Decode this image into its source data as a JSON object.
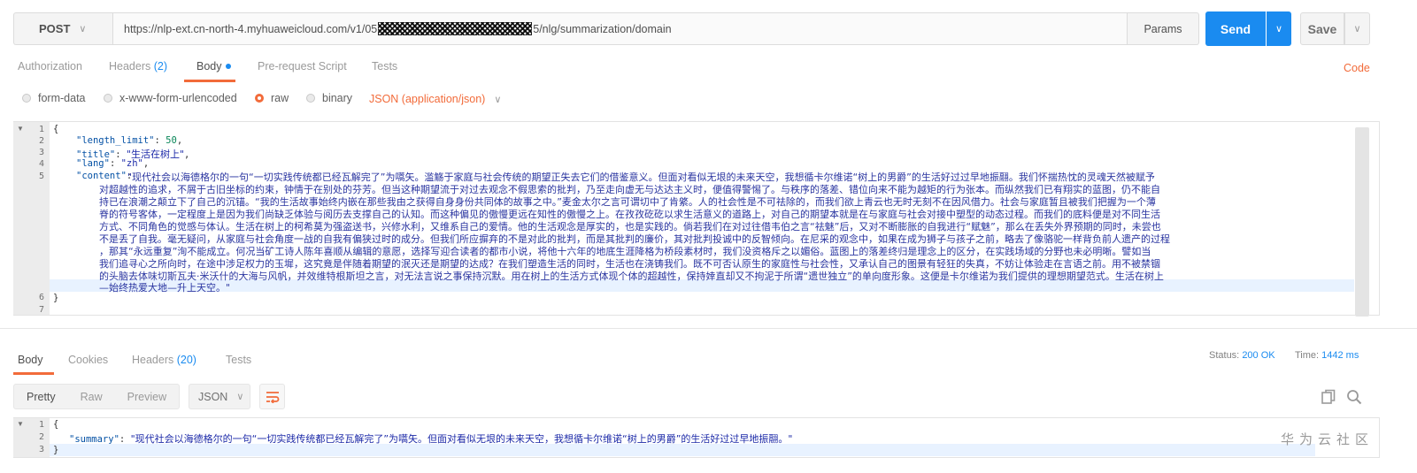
{
  "request": {
    "method": "POST",
    "url_prefix": "https://nlp-ext.cn-north-4.myhuaweicloud.com/v1/05",
    "url_suffix": "5/nlg/summarization/domain",
    "params_label": "Params",
    "send_label": "Send",
    "save_label": "Save"
  },
  "tabs": [
    {
      "label": "Authorization"
    },
    {
      "label": "Headers",
      "count": "(2)"
    },
    {
      "label": "Body"
    },
    {
      "label": "Pre-request Script"
    },
    {
      "label": "Tests"
    }
  ],
  "code_link": "Code",
  "body_types": [
    "form-data",
    "x-www-form-urlencoded",
    "raw",
    "binary"
  ],
  "selected_body_type": "raw",
  "content_type": "JSON (application/json)",
  "editor": {
    "line_numbers": [
      "1",
      "2",
      "3",
      "4",
      "5",
      "6",
      "7"
    ],
    "length_limit_key": "\"length_limit\"",
    "length_limit_value": "50",
    "title_key": "\"title\"",
    "title_value": "\"生活在树上\"",
    "lang_key": "\"lang\"",
    "lang_value": "\"zh\"",
    "content_key": "\"content\"",
    "content_lines": [
      "\"现代社会以海德格尔的一句“一切实践传统都已经瓦解完了”为嚆矢。滥觞于家庭与社会传统的期望正失去它们的借鉴意义。但面对看似无垠的未来天空，我想循卡尔维诺“树上的男爵”的生活好过过早地振翮。我们怀揣热忱的灵魂天然被赋予",
      "对超越性的追求，不屑于古旧坐标的约束，钟情于在别处的芬芳。但当这种期望流于对过去观念不假思索的批判，乃至走向虚无与达达主义时，便值得警惕了。与秩序的落差、错位向来不能为越矩的行为张本。而纵然我们已有翔实的蓝图，仍不能自",
      "持已在浪潮之颠立下了自己的沉锚。“我的生活故事始终内嵌在那些我由之获得自身身份共同体的故事之中。”麦金太尔之言可谓切中了肯綮。人的社会性是不可祛除的，而我们欲上青云也无时无刻不在因风借力。社会与家庭暂且被我们把握为一个薄",
      "脊的符号客体，一定程度上是因为我们尚缺乏体验与阅历去支撑自己的认知。而这种偏见的傲慢更远在知性的傲慢之上。在孜孜矻矻以求生活意义的道路上，对自己的期望本就是在与家庭与社会对接中塑型的动态过程。而我们的底料便是对不同生活",
      "方式、不同角色的觉感与体认。生活在树上的柯希莫为强盗送书，兴修水利，又维系自己的爱情。他的生活观念是厚实的，也是实践的。倘若我们在对过往借韦伯之言“祛魅”后，又对不断膨胀的自我进行“赋魅”，那么在丢失外界预期的同时，未尝也",
      "不是丢了自我。毫无疑问，从家庭与社会角度一战的自我有偏狭过时的成分。但我们所应摒弃的不是对此的批判，而是其批判的廉价，其对批判投诚中的反智倾向。在尼采的观念中，如果在成为狮子与孩子之前，略去了像骆驼一样背负前人遗产的过程",
      "，那其“永远重复”洵不能成立。何况当矿工诗人陈年喜顺从编辑的意愿，选择写迎合读者的都市小说，将他十六年的地底生涯降格为桥段素材时，我们没资格斥之以媚俗。蓝图上的落差终归是理念上的区分，在实践场域的分野也未必明晰。譬如当",
      "我们追寻心之所向时，在途中涉足权力的玉墀，这究竟是伴随着期望的泯灭还是期望的达成？在我们塑造生活的同时，生活也在浇铸我们。既不可否认原生的家庭性与社会性，又承认自己的图景有轻狂的失真，不妨让体验走在言语之前。用不被禁锢",
      "的头脑去体味切斯瓦夫·米沃什的大海与风帆，并效维特根斯坦之言，对无法言说之事保持沉默。用在树上的生活方式体现个体的超越性，保持婞直却又不拘泥于所谓“遗世独立”的单向度形象。这便是卡尔维诺为我们提供的理想期望范式。生活在树上",
      "—始终热爱大地—升上天空。\""
    ]
  },
  "response": {
    "tabs": [
      {
        "label": "Body"
      },
      {
        "label": "Cookies"
      },
      {
        "label": "Headers",
        "count": "(20)"
      },
      {
        "label": "Tests"
      }
    ],
    "status_label": "Status:",
    "status_value": "200 OK",
    "time_label": "Time:",
    "time_value": "1442 ms",
    "view_modes": [
      "Pretty",
      "Raw",
      "Preview"
    ],
    "format": "JSON",
    "line_numbers": [
      "1",
      "2",
      "3"
    ],
    "summary_key": "\"summary\"",
    "summary_value": "\"现代社会以海德格尔的一句“一切实践传统都已经瓦解完了”为嚆矢。但面对看似无垠的未来天空，我想循卡尔维诺“树上的男爵”的生活好过过早地振翮。\""
  },
  "watermark": "华为云社区",
  "colors": {
    "accent": "#f26b3a",
    "primary": "#1a8bf0"
  }
}
